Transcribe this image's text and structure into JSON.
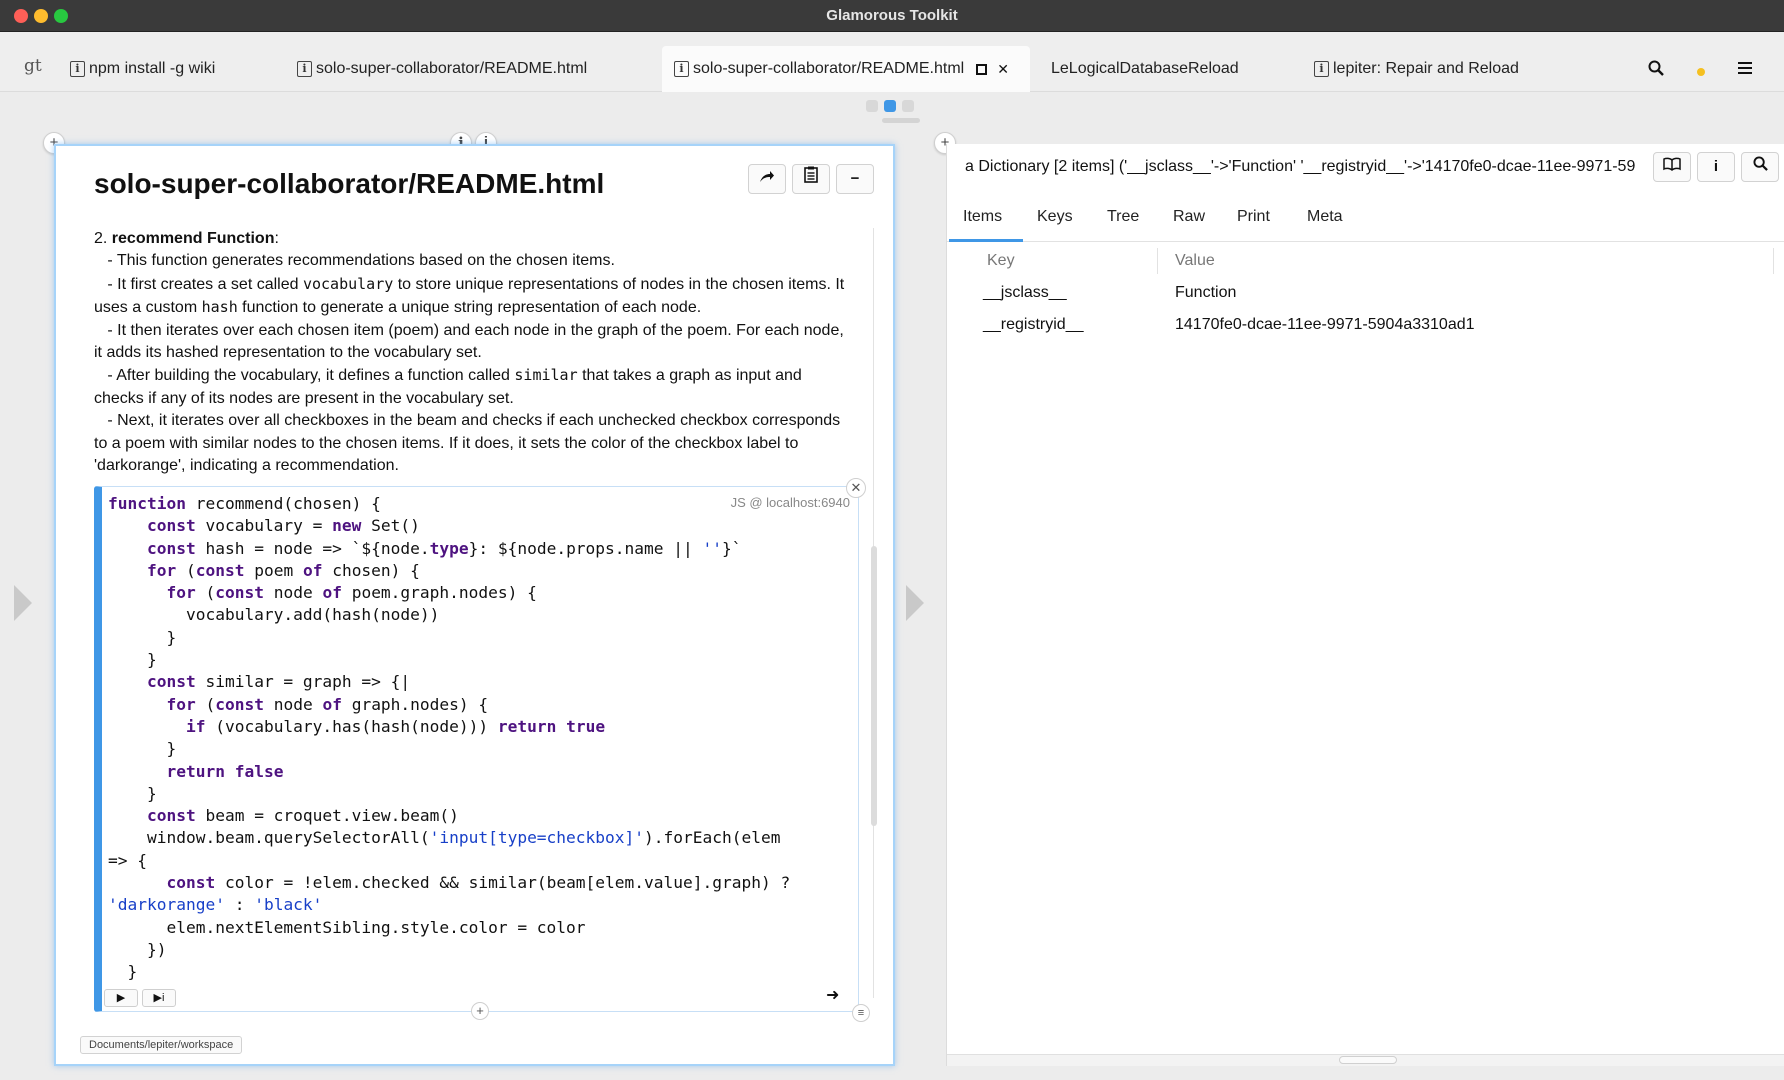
{
  "window": {
    "title": "Glamorous Toolkit"
  },
  "tabstrip": {
    "logo": "gt",
    "tabs": [
      {
        "label": "npm install -g wiki"
      },
      {
        "label": "solo-super-collaborator/README.html"
      },
      {
        "label": "solo-super-collaborator/README.html",
        "active": true
      },
      {
        "label": "LeLogicalDatabaseReload"
      },
      {
        "label": "lepiter: Repair and Reload"
      }
    ],
    "icons": [
      "search-icon",
      "status-dot-icon",
      "hamburger-menu-icon"
    ]
  },
  "left_pane": {
    "title": "solo-super-collaborator/README.html",
    "text": {
      "heading_num": "2. ",
      "heading_bold": "recommend Function",
      "heading_colon": ":",
      "l1": "   - This function generates recommendations based on the chosen items.",
      "l2a": "   - It first creates a set called ",
      "l2code": "vocabulary",
      "l2b": " to store unique representations of nodes in the chosen items. It uses a custom ",
      "l2code2": "hash",
      "l2c": " function to generate a unique string representation of each node.",
      "l3": "   - It then iterates over each chosen item (poem) and each node in the graph of the poem. For each node, it adds its hashed representation to the vocabulary set.",
      "l4a": "   - After building the vocabulary, it defines a function called ",
      "l4code": "similar",
      "l4b": " that takes a graph as input and checks if any of its nodes are present in the vocabulary set.",
      "l5": "   - Next, it iterates over all checkboxes in the beam and checks if each unchecked checkbox corresponds to a poem with similar nodes to the chosen items. If it does, it sets the color of the checkbox label to 'darkorange', indicating a recommendation."
    },
    "code_label": "JS @ localhost:6940",
    "path": "Documents/lepiter/workspace"
  },
  "right_pane": {
    "title": "a Dictionary [2 items] ('__jsclass__'->'Function' '__registryid__'->'14170fe0-dcae-11ee-9971-59",
    "tabs": [
      "Items",
      "Keys",
      "Tree",
      "Raw",
      "Print",
      "Meta"
    ],
    "columns": {
      "key": "Key",
      "value": "Value"
    },
    "rows": [
      {
        "key": "__jsclass__",
        "value": "Function"
      },
      {
        "key": "__registryid__",
        "value": "14170fe0-dcae-11ee-9971-5904a3310ad1"
      }
    ]
  }
}
